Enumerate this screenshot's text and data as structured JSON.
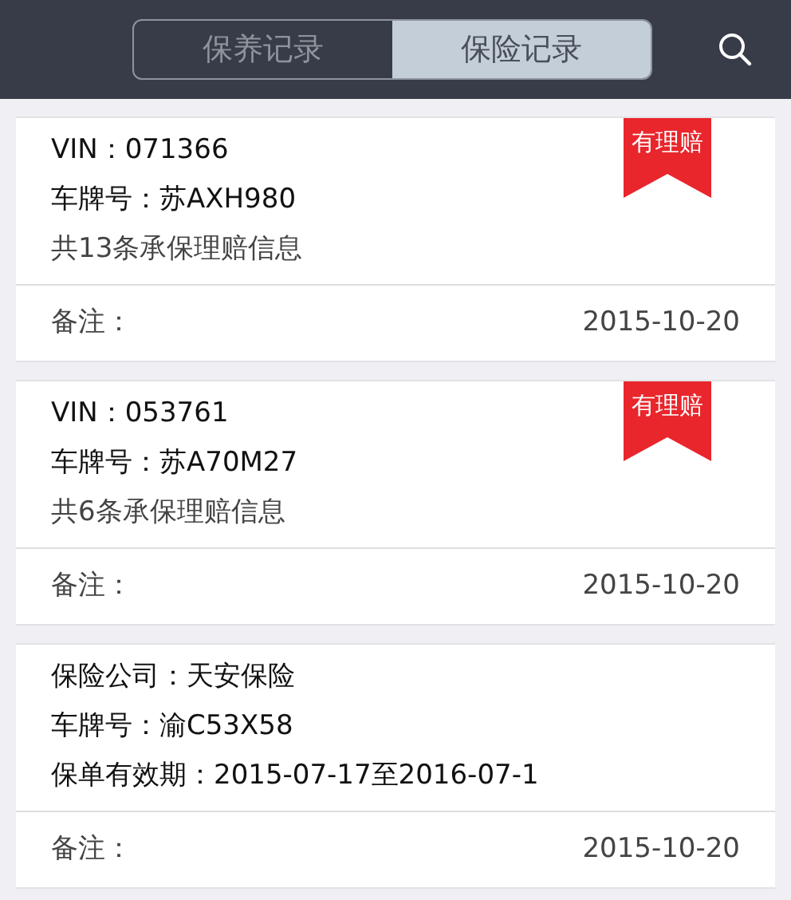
{
  "tabs": [
    {
      "label": "保养记录",
      "selected": false
    },
    {
      "label": "保险记录",
      "selected": true
    }
  ],
  "records": [
    {
      "ribbon": "有理赔",
      "lines": [
        {
          "kind": "field",
          "text": "VIN：071366"
        },
        {
          "kind": "field",
          "text": "车牌号：苏AXH980"
        },
        {
          "kind": "summary",
          "text": "共13条承保理赔信息"
        }
      ],
      "note_label": "备注：",
      "date": "2015-10-20"
    },
    {
      "ribbon": "有理赔",
      "lines": [
        {
          "kind": "field",
          "text": "VIN：053761"
        },
        {
          "kind": "field",
          "text": "车牌号：苏A70M27"
        },
        {
          "kind": "summary",
          "text": "共6条承保理赔信息"
        }
      ],
      "note_label": "备注：",
      "date": "2015-10-20"
    },
    {
      "lines": [
        {
          "kind": "field",
          "text": "保险公司：天安保险"
        },
        {
          "kind": "field",
          "text": "车牌号：渝C53X58"
        },
        {
          "kind": "field",
          "text": "保单有效期：2015-07-17至2016-07-1"
        }
      ],
      "note_label": "备注：",
      "date": "2015-10-20"
    }
  ]
}
